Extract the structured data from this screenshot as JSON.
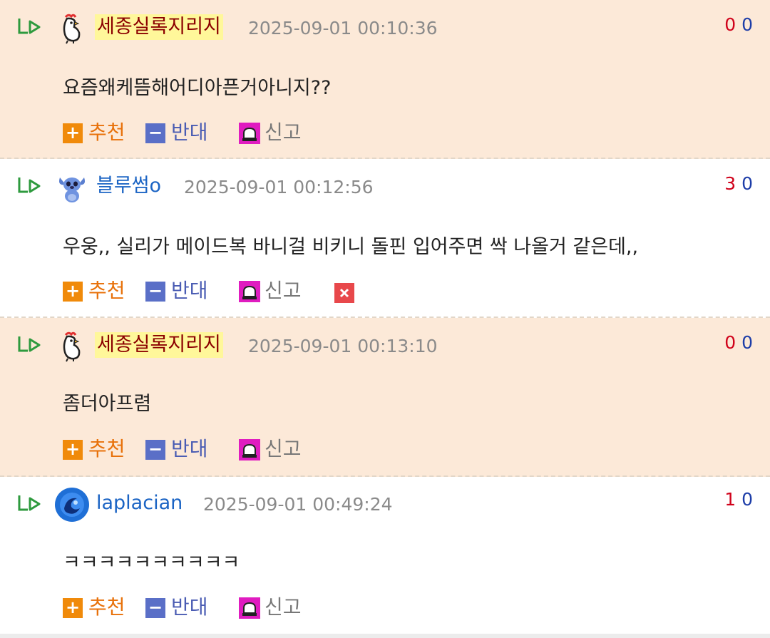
{
  "comments": [
    {
      "nickname": "세종실록지리지",
      "avatar": "rooster-icon",
      "highlighted_nick": true,
      "timestamp": "2025-09-01 00:10:36",
      "votes_up": "0",
      "votes_down": "0",
      "text": "요즘왜케뜸해어디아픈거아니지??",
      "background": "#fce9d8"
    },
    {
      "nickname": "블루썸o",
      "avatar": "stitch-avatar",
      "highlighted_nick": false,
      "timestamp": "2025-09-01 00:12:56",
      "votes_up": "3",
      "votes_down": "0",
      "text": "우웅,, 실리가 메이드복 바니걸 비키니 돌핀 입어주면 싹 나올거 같은데,,",
      "background": "#ffffff"
    },
    {
      "nickname": "세종실록지리지",
      "avatar": "rooster-icon",
      "highlighted_nick": true,
      "timestamp": "2025-09-01 00:13:10",
      "votes_up": "0",
      "votes_down": "0",
      "text": "좀더아프렴",
      "background": "#fce9d8"
    },
    {
      "nickname": "laplacian",
      "avatar": "blue-swirl-avatar",
      "highlighted_nick": false,
      "timestamp": "2025-09-01 00:49:24",
      "votes_up": "1",
      "votes_down": "0",
      "text": "ㅋㅋㅋㅋㅋㅋㅋㅋㅋㅋ",
      "background": "#ffffff"
    }
  ],
  "actions": {
    "recommend": "추천",
    "oppose": "반대",
    "report": "신고"
  },
  "icons": {
    "recommend": "plus-box-icon",
    "oppose": "minus-box-icon",
    "report": "siren-icon",
    "delete": "close-box-icon",
    "reply": "reply-arrow-icon"
  },
  "colors": {
    "highlight_bg": "#fce9d8",
    "nick_blue": "#1b64c4",
    "nick_mark": "#fff79a",
    "recommend": "#f08a0a",
    "oppose": "#5a6fc7",
    "vote_up": "#d0021b",
    "vote_down": "#1d3da8"
  }
}
